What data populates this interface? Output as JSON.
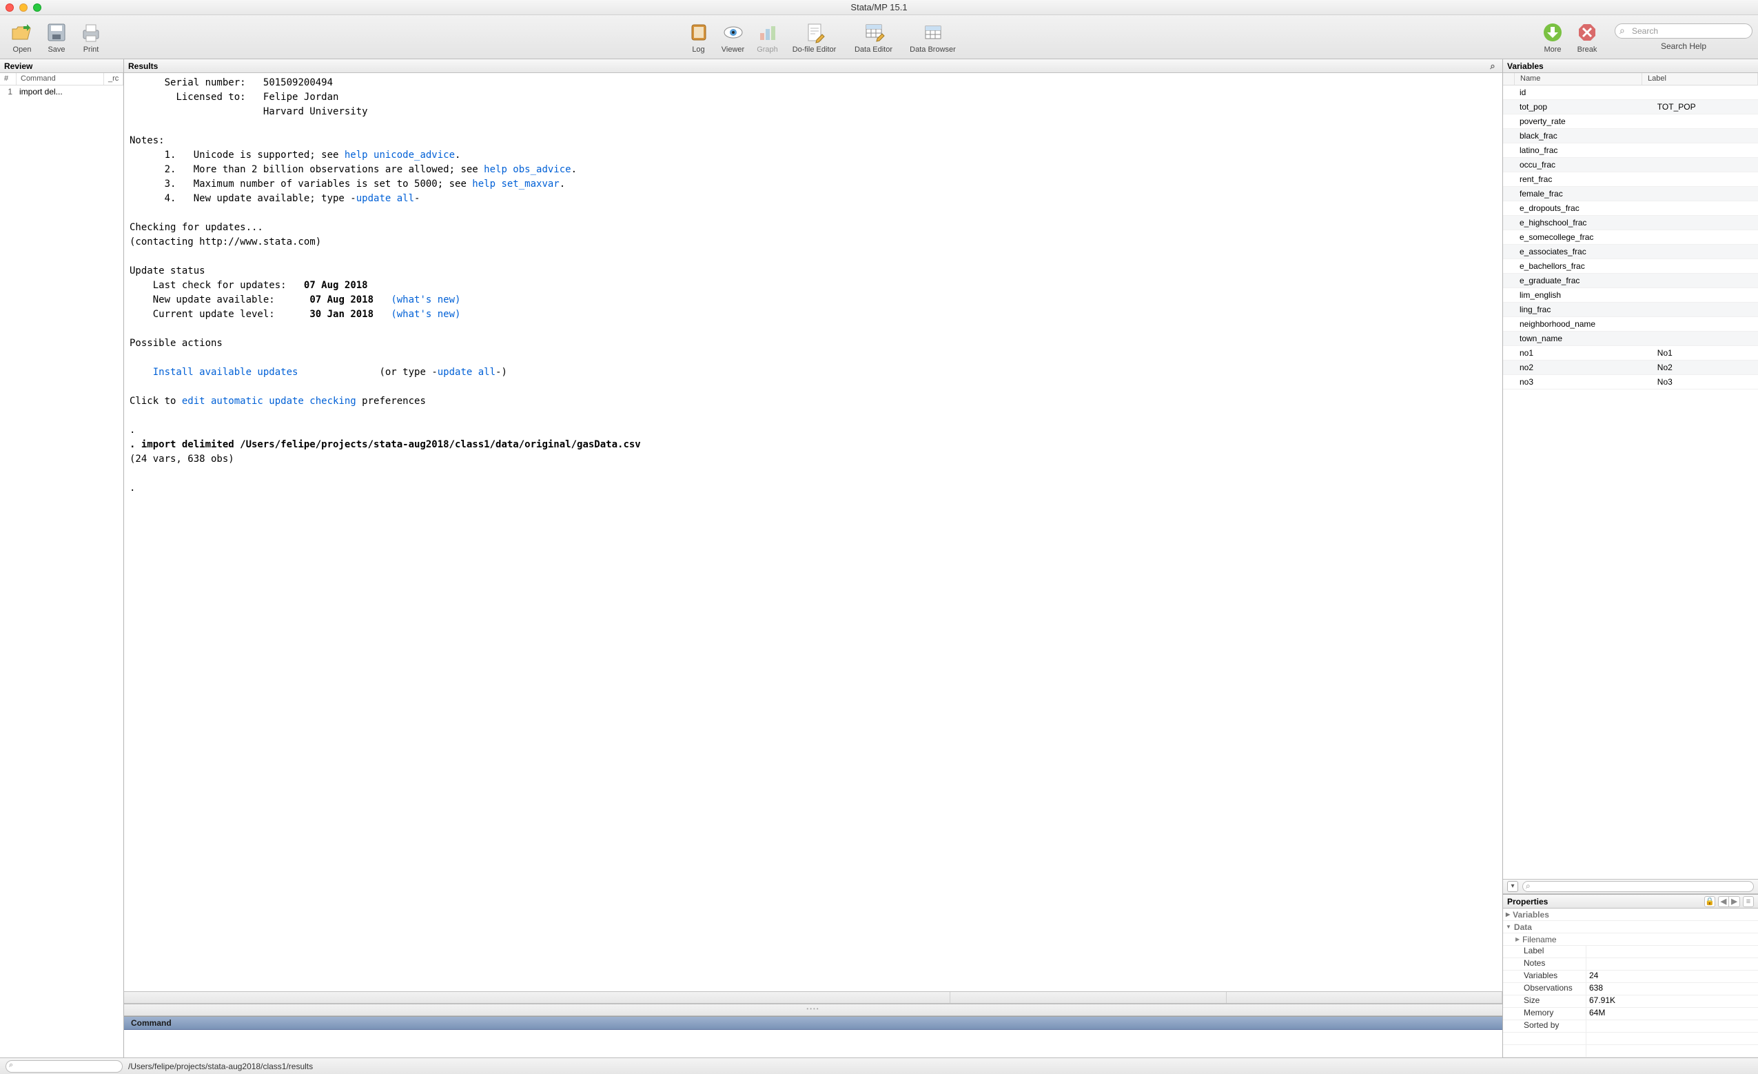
{
  "window_title": "Stata/MP 15.1",
  "toolbar": {
    "open": "Open",
    "save": "Save",
    "print": "Print",
    "log": "Log",
    "viewer": "Viewer",
    "graph": "Graph",
    "dofile": "Do-file Editor",
    "dataed": "Data Editor",
    "databr": "Data Browser",
    "more": "More",
    "break": "Break",
    "search_placeholder": "Search",
    "search_help": "Search Help"
  },
  "review": {
    "title": "Review",
    "col_command": "Command",
    "col_rc": "_rc",
    "rows": [
      {
        "n": "1",
        "cmd": "import del..."
      }
    ]
  },
  "results": {
    "title": "Results",
    "serial_label": "Serial number:",
    "serial": "501509200494",
    "licensed_label": "Licensed to:",
    "licensed1": "Felipe Jordan",
    "licensed2": "Harvard University",
    "notes_label": "Notes:",
    "note1_pre": "Unicode is supported; see ",
    "note1_link": "help unicode_advice",
    "note2_pre": "More than 2 billion observations are allowed; see ",
    "note2_link": "help obs_advice",
    "note3_pre": "Maximum number of variables is set to 5000; see ",
    "note3_link": "help set_maxvar",
    "note4_pre": "New update available; type ",
    "note4_link": "update all",
    "checking": "Checking for updates...",
    "contacting": "(contacting http://www.stata.com)",
    "update_status": "Update status",
    "last_check_label": "Last check for updates:",
    "last_check_date": "07 Aug 2018",
    "new_update_label": "New update available:",
    "new_update_date": "07 Aug 2018",
    "whats_new": "(what's new)",
    "current_level_label": "Current update level:",
    "current_level_date": "30 Jan 2018",
    "possible_actions": "Possible actions",
    "install_link": "Install available updates",
    "install_tail": "(or type ",
    "update_all_link": "update all",
    "click_pre": "Click to ",
    "edit_link": "edit automatic update checking",
    "click_post": " preferences",
    "import_cmd": ". import delimited /Users/felipe/projects/stata-aug2018/class1/data/original/gasData.csv",
    "import_result": "(24 vars, 638 obs)",
    "command_title": "Command"
  },
  "variables": {
    "title": "Variables",
    "col_name": "Name",
    "col_label": "Label",
    "rows": [
      {
        "name": "id",
        "label": ""
      },
      {
        "name": "tot_pop",
        "label": "TOT_POP"
      },
      {
        "name": "poverty_rate",
        "label": ""
      },
      {
        "name": "black_frac",
        "label": ""
      },
      {
        "name": "latino_frac",
        "label": ""
      },
      {
        "name": "occu_frac",
        "label": ""
      },
      {
        "name": "rent_frac",
        "label": ""
      },
      {
        "name": "female_frac",
        "label": ""
      },
      {
        "name": "e_dropouts_frac",
        "label": ""
      },
      {
        "name": "e_highschool_frac",
        "label": ""
      },
      {
        "name": "e_somecollege_frac",
        "label": ""
      },
      {
        "name": "e_associates_frac",
        "label": ""
      },
      {
        "name": "e_bachellors_frac",
        "label": ""
      },
      {
        "name": "e_graduate_frac",
        "label": ""
      },
      {
        "name": "lim_english",
        "label": ""
      },
      {
        "name": "ling_frac",
        "label": ""
      },
      {
        "name": "neighborhood_name",
        "label": ""
      },
      {
        "name": "town_name",
        "label": ""
      },
      {
        "name": "no1",
        "label": "No1"
      },
      {
        "name": "no2",
        "label": "No2"
      },
      {
        "name": "no3",
        "label": "No3"
      }
    ]
  },
  "properties": {
    "title": "Properties",
    "sec_variables": "Variables",
    "sec_data": "Data",
    "filename": "Filename",
    "label_k": "Label",
    "notes": "Notes",
    "variables_k": "Variables",
    "variables_v": "24",
    "observations_k": "Observations",
    "observations_v": "638",
    "size_k": "Size",
    "size_v": "67.91K",
    "memory_k": "Memory",
    "memory_v": "64M",
    "sortedby_k": "Sorted by"
  },
  "statusbar": {
    "path": "/Users/felipe/projects/stata-aug2018/class1/results"
  }
}
